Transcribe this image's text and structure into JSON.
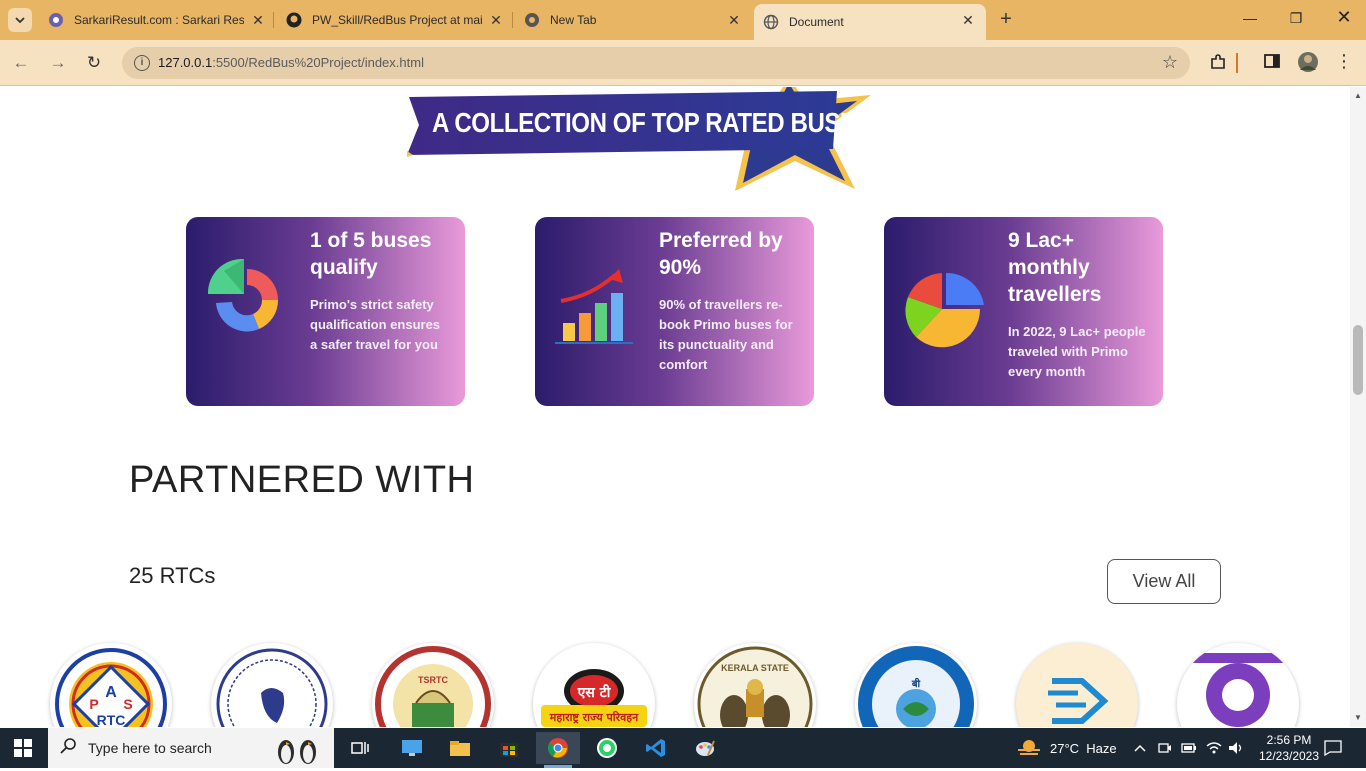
{
  "browser": {
    "tabs": [
      {
        "title": "SarkariResult.com : Sarkari Resu",
        "active": false
      },
      {
        "title": "PW_Skill/RedBus Project at mai",
        "active": false
      },
      {
        "title": "New Tab",
        "active": false
      },
      {
        "title": "Document",
        "active": true
      }
    ],
    "url": {
      "host": "127.0.0.1",
      "path": ":5500/RedBus%20Project/index.html"
    }
  },
  "page": {
    "banner_text": "A COLLECTION OF TOP RATED BUSES",
    "cards": [
      {
        "title": "1 of 5 buses qualify",
        "desc": "Primo's strict safety qualification ensures a safer travel for you",
        "icon": "donut-chart-icon"
      },
      {
        "title": "Preferred by 90%",
        "desc": "90% of travellers re-book Primo buses for its punctuality and comfort",
        "icon": "growth-bar-chart-icon"
      },
      {
        "title": "9 Lac+ monthly travellers",
        "desc": "In 2022, 9 Lac+ people traveled with Primo every month",
        "icon": "pie-chart-icon"
      }
    ],
    "partnered_heading": "PARTNERED WITH",
    "rtc_count": "25 RTCs",
    "view_all_label": "View All",
    "partner_logos": [
      {
        "name": "apsrtc-logo",
        "text": "APSRTC"
      },
      {
        "name": "rtc-logo-2",
        "text": ""
      },
      {
        "name": "tsrtc-logo",
        "text": "TSRTC"
      },
      {
        "name": "msrtc-logo",
        "text": "एस टी"
      },
      {
        "name": "kerala-rtc-logo",
        "text": "KERALA STATE"
      },
      {
        "name": "rtc-logo-6",
        "text": ""
      },
      {
        "name": "rtc-logo-7",
        "text": ""
      },
      {
        "name": "rtc-logo-8",
        "text": ""
      }
    ]
  },
  "taskbar": {
    "search_placeholder": "Type here to search",
    "weather": "27°C  Haze",
    "time": "2:56 PM",
    "date": "12/23/2023"
  },
  "colors": {
    "tab_bar": "#e8b565",
    "toolbar": "#f6e2c0",
    "card_gradient_start": "#2b1c6b",
    "card_gradient_end": "#e99ad9",
    "banner_blue": "#2c2f8f",
    "banner_gold": "#f5c24b"
  }
}
